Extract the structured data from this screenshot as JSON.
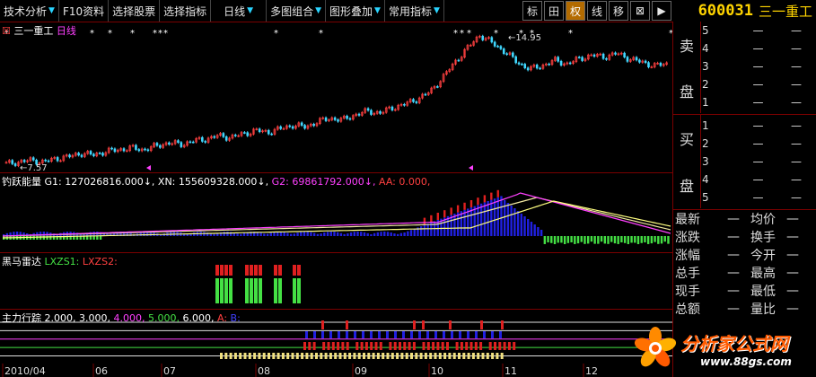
{
  "toolbar": {
    "items": [
      {
        "label": "技术分析",
        "arrow": "▼"
      },
      {
        "label": "F10资料",
        "arrow": ""
      },
      {
        "label": "选择股票",
        "arrow": ""
      },
      {
        "label": "选择指标",
        "arrow": ""
      },
      {
        "label": "日线",
        "arrow": "▼"
      },
      {
        "label": "多图组合",
        "arrow": "▼"
      },
      {
        "label": "图形叠加",
        "arrow": "▼"
      },
      {
        "label": "常用指标",
        "arrow": "▼"
      }
    ],
    "small_buttons": [
      "标",
      "田",
      "权",
      "线",
      "移",
      "⊠",
      "▶"
    ]
  },
  "stock": {
    "code": "600031",
    "name": "三一重工"
  },
  "main_panel": {
    "title_icon": "☒",
    "name": "三一重工",
    "period": "日线",
    "high_label": "14.95",
    "low_label": "7.57"
  },
  "volume_panel": {
    "title": "钓跃能量",
    "g1": "G1: 127026816.000↓,",
    "xn": "XN: 155609328.000↓,",
    "g2": "G2: 69861792.000↓,",
    "aa": "AA: 0.000,"
  },
  "horse_panel": {
    "title": "黑马雷达",
    "lxzs1": "LXZS1:",
    "lxzs2": "LXZS2:"
  },
  "main_force_panel": {
    "title": "主力行踪",
    "v1": "2.000,",
    "v2": "3.000,",
    "v3": "4.000,",
    "v4": "5.000,",
    "v5": "6.000,",
    "a": "A:",
    "b": "B:"
  },
  "x_axis": {
    "labels": [
      "2010/04",
      "06",
      "07",
      "08",
      "09",
      "10",
      "11",
      "12"
    ]
  },
  "order_book": {
    "sell_label": "卖盘",
    "sell_chars": [
      "卖",
      "盘"
    ],
    "buy_chars": [
      "买",
      "盘"
    ],
    "sell_levels": [
      "5",
      "4",
      "3",
      "2",
      "1"
    ],
    "buy_levels": [
      "1",
      "2",
      "3",
      "4",
      "5"
    ],
    "dash": "—"
  },
  "stats": [
    {
      "k1": "最新",
      "v1": "—",
      "k2": "均价",
      "v2": "—"
    },
    {
      "k1": "涨跌",
      "v1": "—",
      "k2": "换手",
      "v2": "—"
    },
    {
      "k1": "涨幅",
      "v1": "—",
      "k2": "今开",
      "v2": "—"
    },
    {
      "k1": "总手",
      "v1": "—",
      "k2": "最高",
      "v2": "—"
    },
    {
      "k1": "现手",
      "v1": "—",
      "k2": "最低",
      "v2": "—"
    },
    {
      "k1": "总额",
      "v1": "—",
      "k2": "量比",
      "v2": "—"
    }
  ],
  "logo": {
    "title": "分析家公式网",
    "url": "www.88gs.com"
  },
  "colors": {
    "up": "#ff4040",
    "down": "#40d8ff",
    "border": "#7a0000",
    "yellow": "#ffd400",
    "magenta": "#ff40ff",
    "green": "#44e044",
    "blue": "#2020e0",
    "red": "#e02020",
    "cream": "#f0e6a0"
  },
  "chart_data": {
    "type": "candlestick",
    "series": [
      {
        "name": "三一重工",
        "values": [
          7.6,
          7.7,
          7.8,
          7.7,
          7.9,
          8.0,
          8.2,
          8.1,
          8.3,
          8.4,
          8.5,
          8.4,
          8.6,
          8.8,
          8.7,
          8.9,
          9.0,
          9.2,
          9.1,
          9.3,
          9.5,
          9.4,
          9.6,
          9.8,
          9.7,
          10.0,
          10.2,
          10.1,
          10.4,
          10.6,
          10.5,
          10.8,
          11.0,
          11.3,
          11.7,
          12.5,
          13.4,
          14.2,
          14.95,
          14.5,
          14.0,
          13.4,
          13.0,
          13.2,
          13.5,
          13.3,
          13.6,
          13.8,
          13.7,
          13.9,
          13.6,
          13.4,
          13.2,
          13.3
        ]
      }
    ],
    "high": 14.95,
    "low": 7.57,
    "xlabels": [
      "2010/04",
      "06",
      "07",
      "08",
      "09",
      "10",
      "11",
      "12"
    ]
  }
}
